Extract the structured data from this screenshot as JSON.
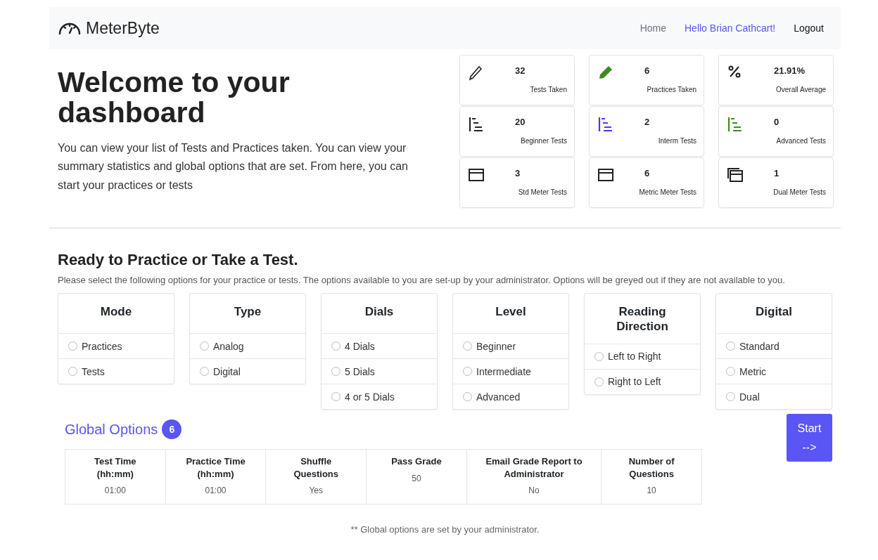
{
  "navbar": {
    "brand": "MeterByte",
    "links": [
      {
        "label": "Home",
        "kind": "muted"
      },
      {
        "label": "Hello Brian Cathcart!",
        "kind": "accent"
      },
      {
        "label": "Logout",
        "kind": "dark"
      }
    ]
  },
  "hero": {
    "title": "Welcome to your dashboard",
    "text": "You can view your list of Tests and Practices taken. You can view your summary statistics and global options that are set. From here, you can start your practices or tests"
  },
  "stats": [
    {
      "value": "32",
      "label": "Tests Taken",
      "kind": "pencil",
      "color": "#222222"
    },
    {
      "value": "6",
      "label": "Practices Taken",
      "kind": "pencil-fill",
      "color": "#3d8b1f"
    },
    {
      "value": "21.91%",
      "label": "Overall Average",
      "kind": "percent",
      "color": "#222222"
    },
    {
      "value": "20",
      "label": "Beginner Tests",
      "kind": "levels",
      "color": "#222222"
    },
    {
      "value": "2",
      "label": "Interm Tests",
      "kind": "levels",
      "color": "#5b2ff5"
    },
    {
      "value": "0",
      "label": "Advanced Tests",
      "kind": "levels",
      "color": "#3d8b1f"
    },
    {
      "value": "3",
      "label": "Std Meter Tests",
      "kind": "window",
      "color": "#222222"
    },
    {
      "value": "6",
      "label": "Metric Meter Tests",
      "kind": "window",
      "color": "#222222"
    },
    {
      "value": "1",
      "label": "Dual Meter Tests",
      "kind": "windows",
      "color": "#222222"
    }
  ],
  "practice": {
    "title": "Ready to Practice or Take a Test.",
    "text": "Please select the following options for your practice or tests. The options available to you are set-up by your administrator. Options will be greyed out if they are not available to you.",
    "groups": [
      {
        "title": "Mode",
        "options": [
          {
            "label": "Practices",
            "selected": false
          },
          {
            "label": "Tests",
            "selected": false
          }
        ]
      },
      {
        "title": "Type",
        "options": [
          {
            "label": "Analog",
            "selected": false
          },
          {
            "label": "Digital",
            "selected": false
          }
        ]
      },
      {
        "title": "Dials",
        "options": [
          {
            "label": "4 Dials",
            "selected": false
          },
          {
            "label": "5 Dials",
            "selected": false
          },
          {
            "label": "4 or 5 Dials",
            "selected": false
          }
        ]
      },
      {
        "title": "Level",
        "options": [
          {
            "label": "Beginner",
            "selected": false
          },
          {
            "label": "Intermediate",
            "selected": false
          },
          {
            "label": "Advanced",
            "selected": false
          }
        ]
      },
      {
        "title": "Reading Direction",
        "options": [
          {
            "label": "Left to Right",
            "selected": false
          },
          {
            "label": "Right to Left",
            "selected": false
          }
        ]
      },
      {
        "title": "Digital",
        "options": [
          {
            "label": "Standard",
            "selected": false
          },
          {
            "label": "Metric",
            "selected": false
          },
          {
            "label": "Dual",
            "selected": false
          }
        ]
      }
    ]
  },
  "global_options": {
    "title": "Global Options",
    "badge": "6",
    "columns": [
      {
        "header": "Test Time (hh:mm)",
        "value": "01:00"
      },
      {
        "header": "Practice Time (hh:mm)",
        "value": "01:00"
      },
      {
        "header": "Shuffle Questions",
        "value": "Yes"
      },
      {
        "header": "Pass Grade",
        "value": "50"
      },
      {
        "header": "Email Grade Report to Administrator",
        "value": "No"
      },
      {
        "header": "Number of Questions",
        "value": "10"
      }
    ],
    "note": "** Global options are set by your administrator."
  },
  "start_button": {
    "label": "Start",
    "arrow": "-->"
  }
}
